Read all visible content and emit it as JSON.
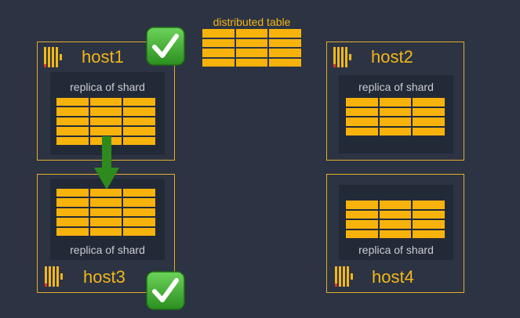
{
  "distributed_table": {
    "label": "distributed table",
    "rows": 4,
    "cols": 3
  },
  "hosts": [
    {
      "id": "host1",
      "name": "host1",
      "shard_label": "replica of shard",
      "status_icon": "check-icon"
    },
    {
      "id": "host2",
      "name": "host2",
      "shard_label": "replica of shard",
      "status_icon": ""
    },
    {
      "id": "host3",
      "name": "host3",
      "shard_label": "replica of shard",
      "status_icon": "check-icon"
    },
    {
      "id": "host4",
      "name": "host4",
      "shard_label": "replica of shard",
      "status_icon": ""
    }
  ],
  "shard_table": {
    "rows": 5,
    "cols": 3
  },
  "replication_arrow": {
    "from": "host1",
    "to": "host3",
    "icon": "arrow-down-icon"
  },
  "colors": {
    "accent": "#f7b30c",
    "border": "#e4ad2a",
    "background": "#2c3343",
    "panel": "#232a37",
    "check_green": "#3aa52b",
    "arrow_green": "#2f8a1e",
    "logo_red": "#e2342b"
  }
}
